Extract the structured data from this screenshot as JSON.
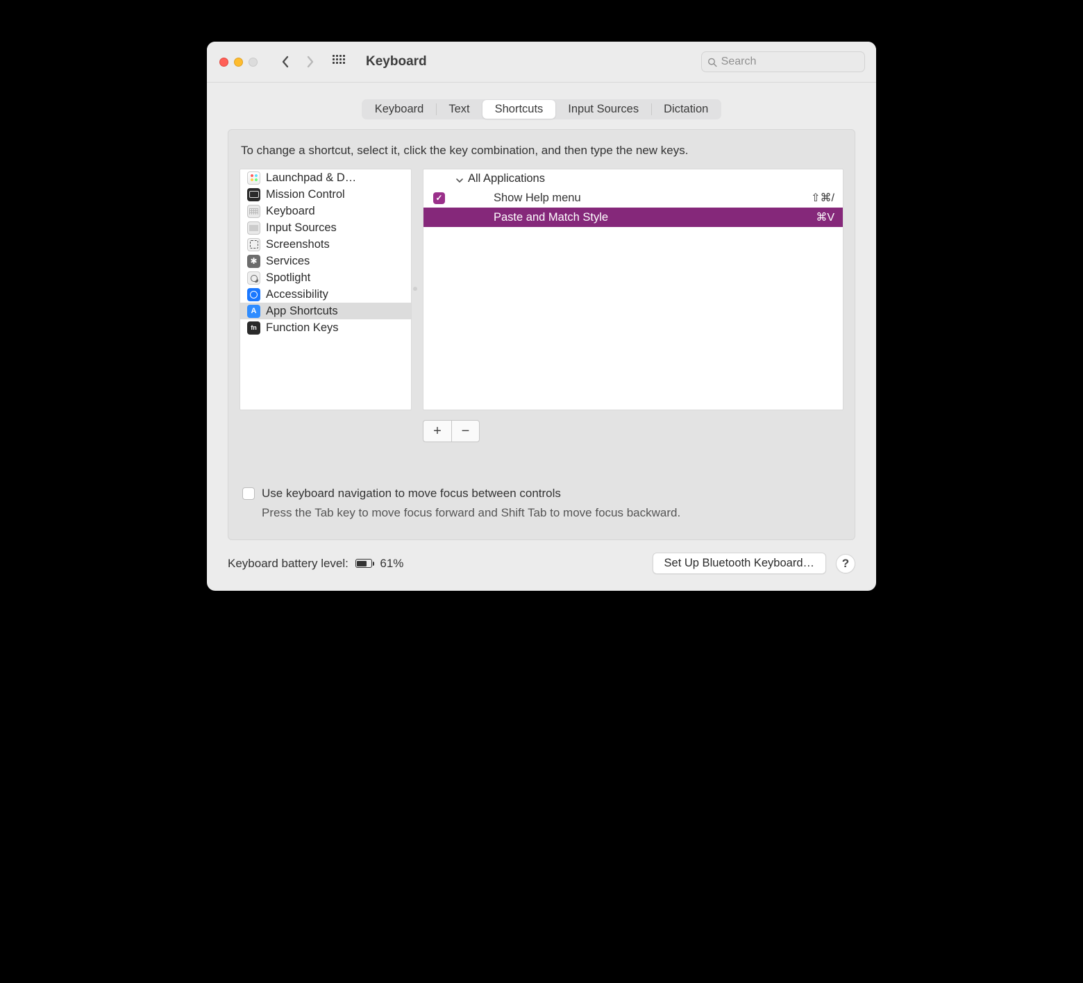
{
  "window": {
    "title": "Keyboard"
  },
  "search": {
    "placeholder": "Search"
  },
  "tabs": {
    "items": [
      {
        "label": "Keyboard"
      },
      {
        "label": "Text"
      },
      {
        "label": "Shortcuts"
      },
      {
        "label": "Input Sources"
      },
      {
        "label": "Dictation"
      }
    ],
    "active_index": 2
  },
  "instruction": "To change a shortcut, select it, click the key combination, and then type the new keys.",
  "categories": [
    {
      "label": "Launchpad & D…",
      "icon": "launchpad"
    },
    {
      "label": "Mission Control",
      "icon": "mission"
    },
    {
      "label": "Keyboard",
      "icon": "keyboard"
    },
    {
      "label": "Input Sources",
      "icon": "input"
    },
    {
      "label": "Screenshots",
      "icon": "screenshot"
    },
    {
      "label": "Services",
      "icon": "services"
    },
    {
      "label": "Spotlight",
      "icon": "spotlight"
    },
    {
      "label": "Accessibility",
      "icon": "accessibility"
    },
    {
      "label": "App Shortcuts",
      "icon": "appshort"
    },
    {
      "label": "Function Keys",
      "icon": "fn"
    }
  ],
  "categories_selected_index": 8,
  "shortcuts": {
    "group_label": "All Applications",
    "rows": [
      {
        "checked": true,
        "name": "Show Help menu",
        "keys": "⇧⌘/",
        "selected": false
      },
      {
        "checked": false,
        "name": "Paste and Match Style",
        "keys": "⌘V",
        "selected": true
      }
    ]
  },
  "buttons": {
    "add": "+",
    "remove": "−"
  },
  "kb_nav": {
    "label": "Use keyboard navigation to move focus between controls",
    "hint": "Press the Tab key to move focus forward and Shift Tab to move focus backward."
  },
  "footer": {
    "battery_label": "Keyboard battery level:",
    "battery_pct": "61%",
    "bluetooth_button": "Set Up Bluetooth Keyboard…",
    "help": "?"
  },
  "colors": {
    "accent": "#85287a"
  }
}
